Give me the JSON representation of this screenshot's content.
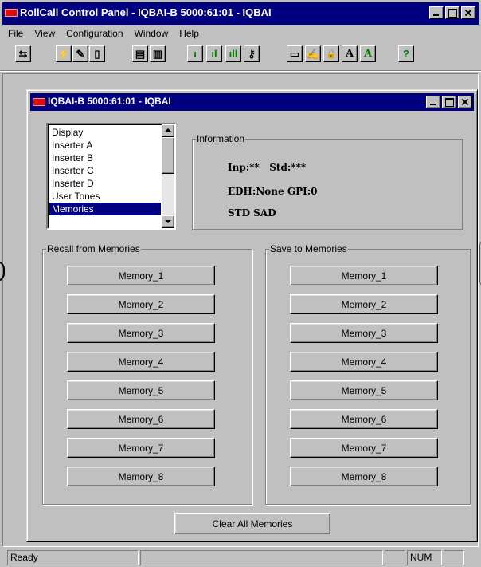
{
  "app": {
    "title": "RollCall Control Panel - IQBAI-B 5000:61:01 - IQBAI"
  },
  "menu": [
    "File",
    "View",
    "Configuration",
    "Window",
    "Help"
  ],
  "toolbar": {
    "buttons": [
      {
        "icon": "network-icon",
        "glyph": "⇆"
      },
      {
        "icon": "lightning-icon",
        "glyph": "⚡"
      },
      {
        "icon": "edit-doc-icon",
        "glyph": "✎"
      },
      {
        "icon": "doc-icon",
        "glyph": "▯"
      },
      {
        "icon": "device-icon",
        "glyph": "▤"
      },
      {
        "icon": "unit-icon",
        "glyph": "▥"
      },
      {
        "icon": "level-low-icon",
        "glyph": "ı"
      },
      {
        "icon": "level-mid-icon",
        "glyph": "ıl"
      },
      {
        "icon": "level-high-icon",
        "glyph": "ıll"
      },
      {
        "icon": "key-icon",
        "glyph": "⚷"
      },
      {
        "icon": "book-icon",
        "glyph": "▭"
      },
      {
        "icon": "edit-form-icon",
        "glyph": "✍"
      },
      {
        "icon": "lock-icon",
        "glyph": "🔒"
      },
      {
        "icon": "font-black-icon",
        "glyph": "A",
        "color": "#000000"
      },
      {
        "icon": "font-green-icon",
        "glyph": "A",
        "color": "#008000"
      },
      {
        "icon": "help-icon",
        "glyph": "?"
      }
    ]
  },
  "child": {
    "title": "IQBAI-B 5000:61:01 - IQBAI",
    "list": {
      "items": [
        "Display",
        "Inserter A",
        "Inserter B",
        "Inserter C",
        "Inserter D",
        "User Tones",
        "Memories"
      ],
      "selected": "Memories"
    },
    "information": {
      "label": "Information",
      "line1": "Inp:**   Std:***",
      "line2": "EDH:None GPI:0",
      "line3": "STD SAD"
    },
    "recall": {
      "label": "Recall from Memories",
      "buttons": [
        "Memory_1",
        "Memory_2",
        "Memory_3",
        "Memory_4",
        "Memory_5",
        "Memory_6",
        "Memory_7",
        "Memory_8"
      ]
    },
    "save": {
      "label": "Save to Memories",
      "buttons": [
        "Memory_1",
        "Memory_2",
        "Memory_3",
        "Memory_4",
        "Memory_5",
        "Memory_6",
        "Memory_7",
        "Memory_8"
      ]
    },
    "clear_label": "Clear All Memories"
  },
  "status": {
    "ready": "Ready",
    "num": "NUM"
  },
  "colors": {
    "titlebar": "#000080",
    "face": "#c0c0c0",
    "selection": "#000080"
  }
}
